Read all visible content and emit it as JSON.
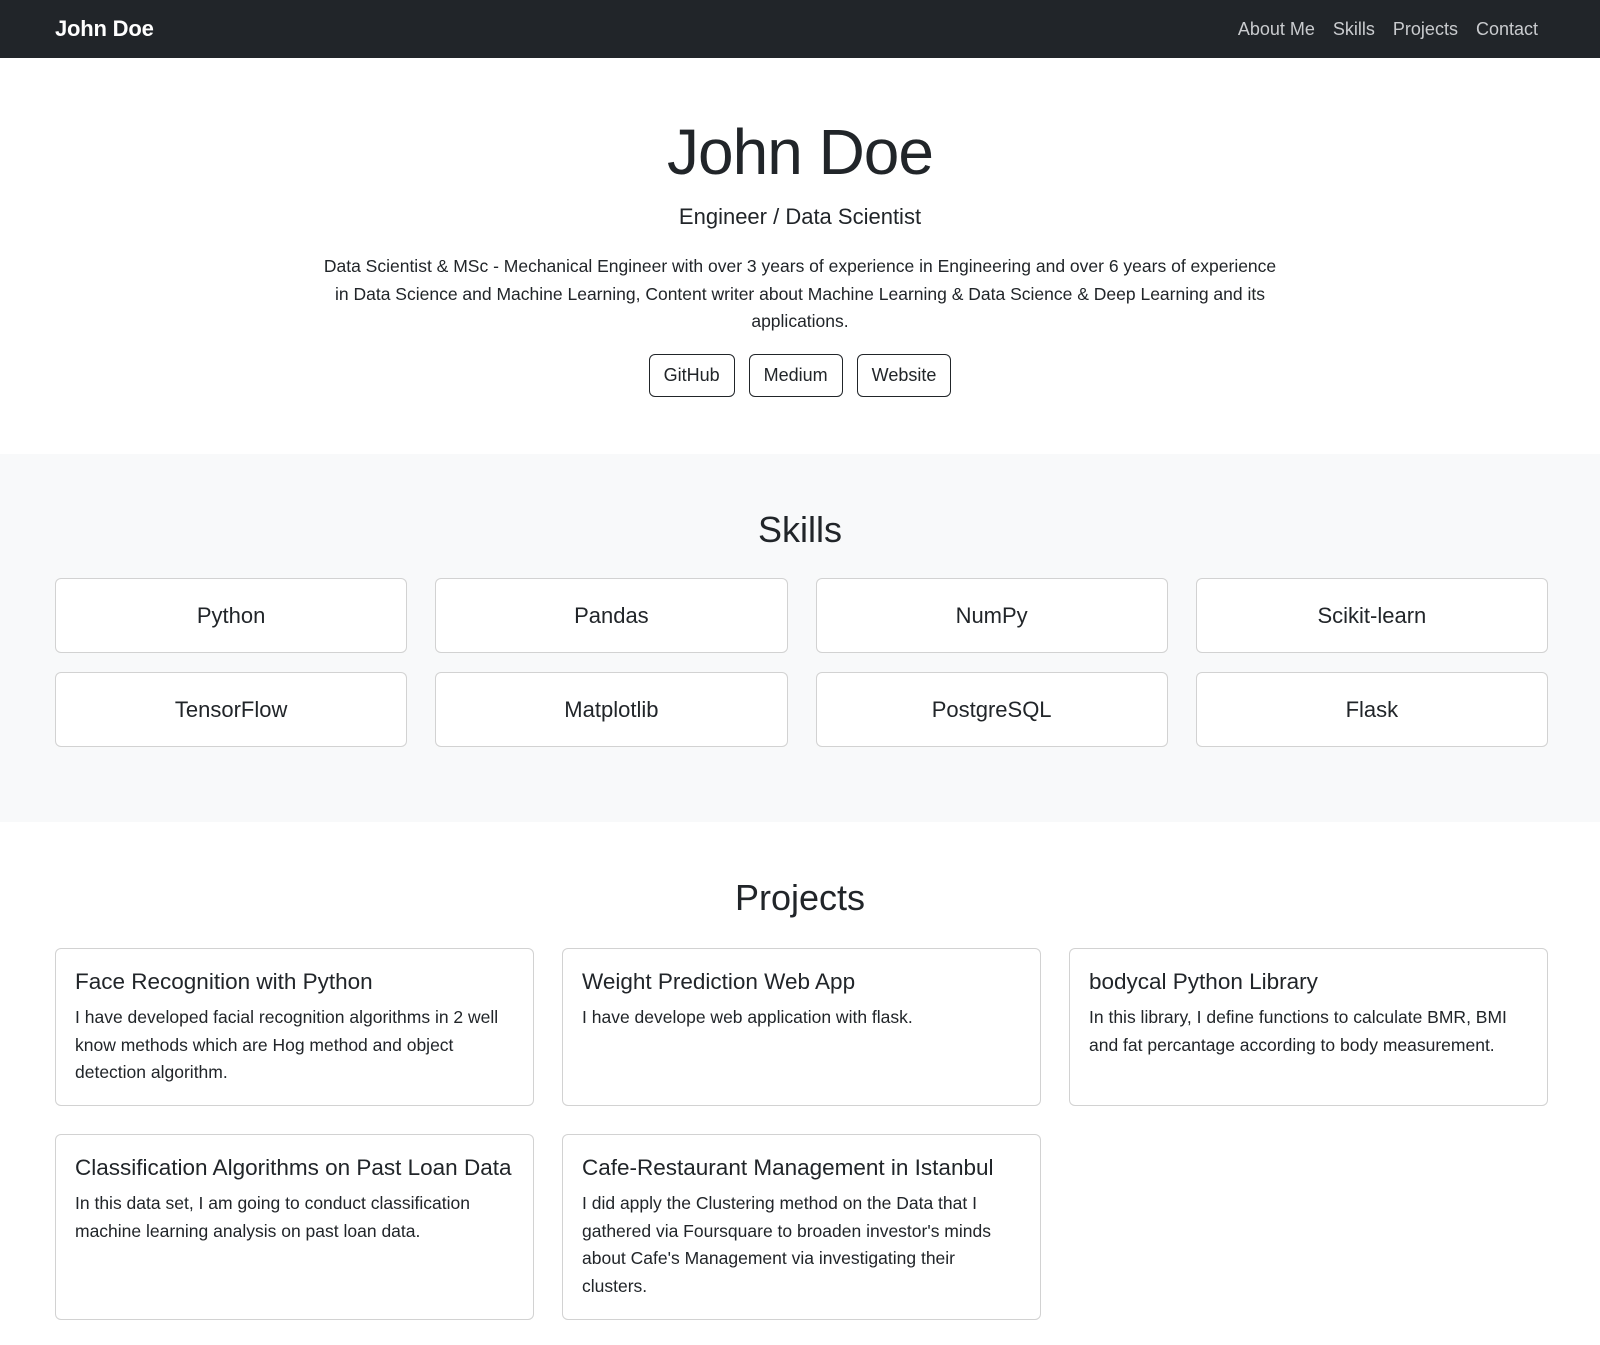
{
  "navbar": {
    "brand": "John Doe",
    "links": [
      "About Me",
      "Skills",
      "Projects",
      "Contact"
    ]
  },
  "hero": {
    "name": "John Doe",
    "role": "Engineer / Data Scientist",
    "bio": "Data Scientist & MSc - Mechanical Engineer with over 3 years of experience in Engineering and over 6 years of experience in Data Science and Machine Learning, Content writer about Machine Learning & Data Science & Deep Learning and its applications.",
    "buttons": [
      "GitHub",
      "Medium",
      "Website"
    ]
  },
  "skills": {
    "title": "Skills",
    "items": [
      "Python",
      "Pandas",
      "NumPy",
      "Scikit-learn",
      "TensorFlow",
      "Matplotlib",
      "PostgreSQL",
      "Flask"
    ]
  },
  "projects": {
    "title": "Projects",
    "items": [
      {
        "title": "Face Recognition with Python",
        "description": "I have developed facial recognition algorithms in 2 well know methods which are Hog method and object detection algorithm."
      },
      {
        "title": "Weight Prediction Web App",
        "description": "I have develope web application with flask."
      },
      {
        "title": "bodycal Python Library",
        "description": "In this library, I define functions to calculate BMR, BMI and fat percantage according to body measurement."
      },
      {
        "title": "Classification Algorithms on Past Loan Data",
        "description": "In this data set, I am going to conduct classification machine learning analysis on past loan data."
      },
      {
        "title": "Cafe-Restaurant Management in Istanbul",
        "description": "I did apply the Clustering method on the Data that I gathered via Foursquare to broaden investor's minds about Cafe's Management via investigating their clusters."
      }
    ]
  },
  "colors": {
    "navbar_bg": "#212529",
    "section_alt_bg": "#f8f9fa",
    "text": "#212529"
  }
}
